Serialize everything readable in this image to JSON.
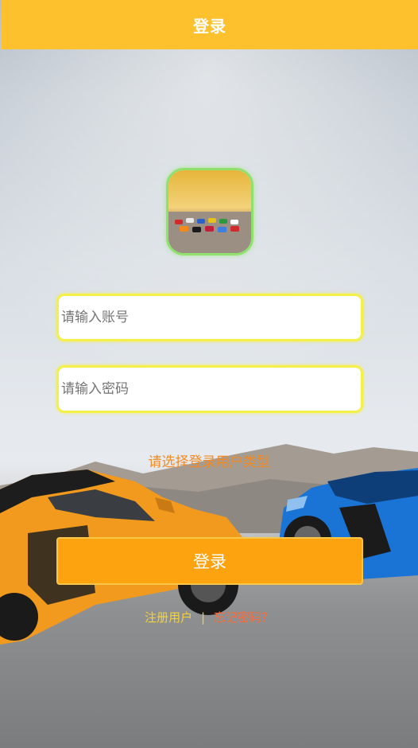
{
  "header": {
    "title": "登录"
  },
  "logo": {
    "icon": "sports-cars-logo-icon"
  },
  "form": {
    "username_placeholder": "请输入账号",
    "password_placeholder": "请输入密码",
    "role_select_label": "请选择登录用户类型",
    "submit_label": "登录"
  },
  "links": {
    "register": "注册用户",
    "separator": "|",
    "forgot": "忘记密码？"
  },
  "colors": {
    "header_bg": "#fdc12e",
    "button_bg": "#fda310",
    "input_border": "#f4f049",
    "role_text": "#f28a22",
    "register_text": "#f5d33b",
    "forgot_text": "#ff6b3a"
  }
}
